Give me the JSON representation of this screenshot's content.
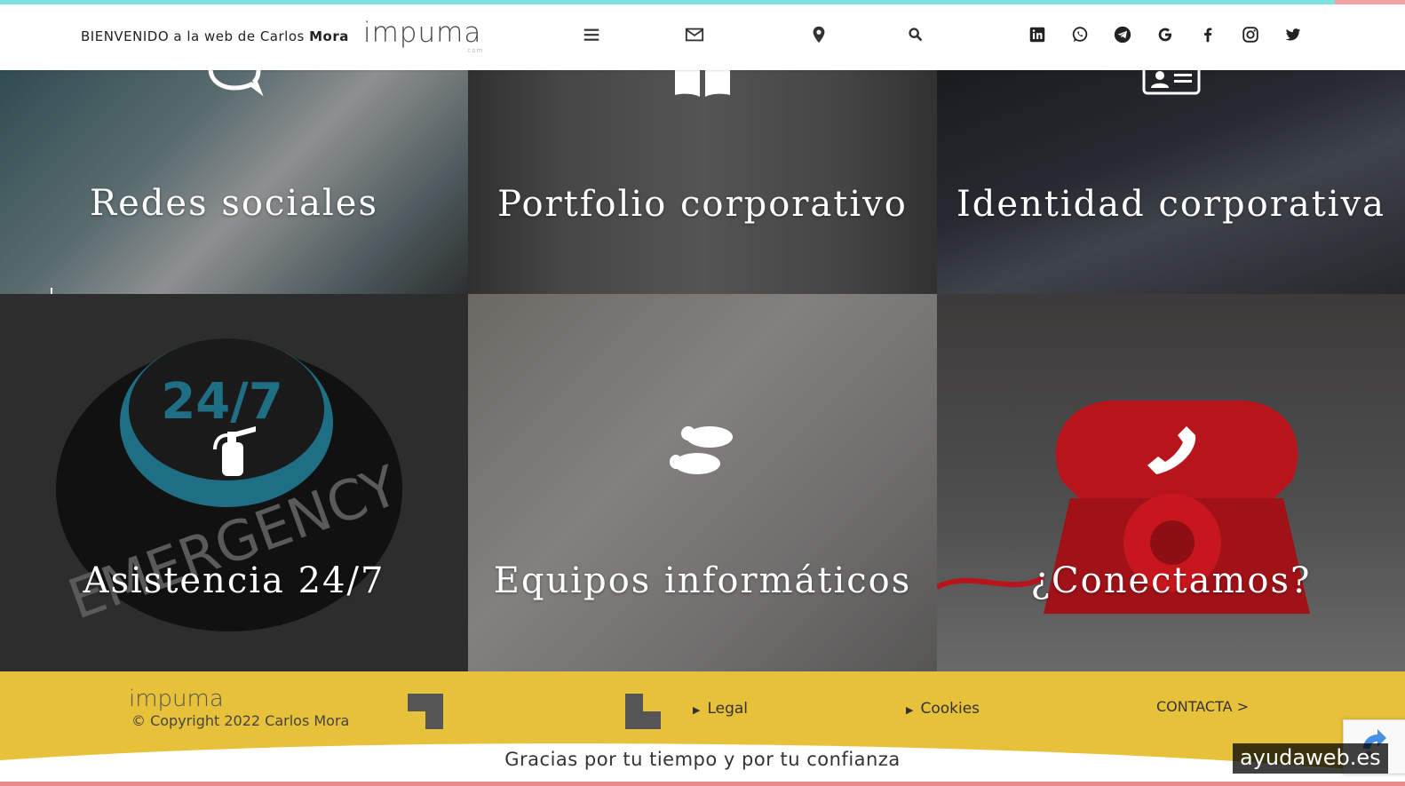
{
  "header": {
    "welcome_prefix": "BIENVENIDO a la web de Carlos",
    "welcome_name": "Mora",
    "logo": "impuma",
    "logo_sub": ".com",
    "icons": [
      "menu-icon",
      "mail-icon",
      "location-pin-icon",
      "search-icon"
    ],
    "social": [
      "linkedin-icon",
      "whatsapp-icon",
      "telegram-icon",
      "google-icon",
      "facebook-icon",
      "instagram-icon",
      "twitter-icon"
    ]
  },
  "tiles": [
    {
      "title": "Redes  sociales",
      "icon": "chat-bubble-icon"
    },
    {
      "title": "Portfolio  corporativo",
      "icon": "book-icon"
    },
    {
      "title": "Identidad  corporativa",
      "icon": "id-card-icon"
    },
    {
      "title": "Asistencia  24/7",
      "icon": "fire-extinguisher-icon"
    },
    {
      "title": "Equipos  informáticos",
      "icon": "footprints-icon"
    },
    {
      "title": "¿Conectamos?",
      "icon": "phone-icon"
    }
  ],
  "footer": {
    "logo": "impuma",
    "copyright": "© Copyright 2022 Carlos Mora",
    "legal": "Legal",
    "cookies": "Cookies",
    "contact": "CONTACTA  >",
    "thanks": "Gracias por tu tiempo y por tu confianza"
  },
  "watermark": "ayudaweb.es",
  "colors": {
    "footer_bg": "#e8c13a",
    "accent_top": "#7ee3e0",
    "accent_bottom": "#e98a8a"
  }
}
